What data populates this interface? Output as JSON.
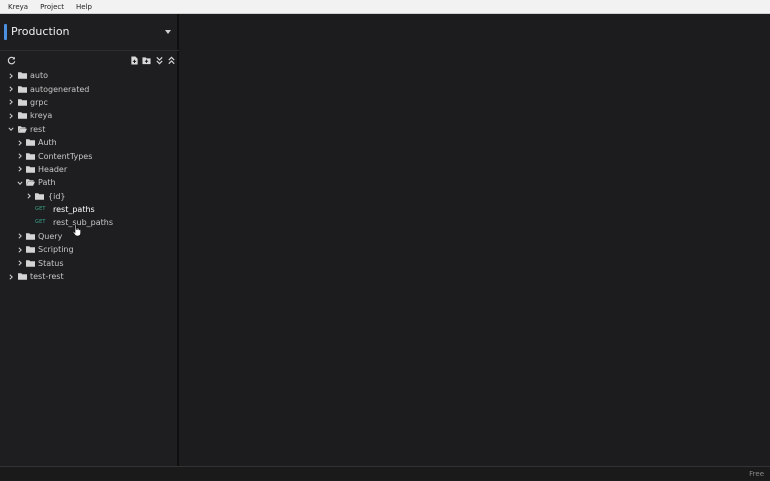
{
  "menu": [
    "Kreya",
    "Project",
    "Help"
  ],
  "environment": {
    "name": "Production",
    "accent": "#4a8fe0"
  },
  "toolbar": {
    "refresh_icon": "refresh-icon",
    "new_file_icon": "new-file-icon",
    "new_folder_icon": "new-folder-icon",
    "expand_all_icon": "chevrons-down-icon",
    "collapse_all_icon": "chevrons-up-icon"
  },
  "tree": [
    {
      "label": "auto",
      "type": "folder",
      "expanded": false,
      "depth": 0
    },
    {
      "label": "autogenerated",
      "type": "folder",
      "expanded": false,
      "depth": 0
    },
    {
      "label": "grpc",
      "type": "folder",
      "expanded": false,
      "depth": 0
    },
    {
      "label": "kreya",
      "type": "folder",
      "expanded": false,
      "depth": 0
    },
    {
      "label": "rest",
      "type": "folder",
      "expanded": true,
      "depth": 0
    },
    {
      "label": "Auth",
      "type": "folder",
      "expanded": false,
      "depth": 1
    },
    {
      "label": "ContentTypes",
      "type": "folder",
      "expanded": false,
      "depth": 1
    },
    {
      "label": "Header",
      "type": "folder",
      "expanded": false,
      "depth": 1
    },
    {
      "label": "Path",
      "type": "folder",
      "expanded": true,
      "depth": 1
    },
    {
      "label": "{id}",
      "type": "folder",
      "expanded": false,
      "depth": 2
    },
    {
      "label": "rest_paths",
      "type": "operation",
      "verb": "GET",
      "depth": 2,
      "selected": true
    },
    {
      "label": "rest_sub_paths",
      "type": "operation",
      "verb": "GET",
      "depth": 2
    },
    {
      "label": "Query",
      "type": "folder",
      "expanded": false,
      "depth": 1
    },
    {
      "label": "Scripting",
      "type": "folder",
      "expanded": false,
      "depth": 1
    },
    {
      "label": "Status",
      "type": "folder",
      "expanded": false,
      "depth": 1
    },
    {
      "label": "test-rest",
      "type": "folder",
      "expanded": false,
      "depth": 0
    }
  ],
  "status": {
    "plan": "Free"
  }
}
